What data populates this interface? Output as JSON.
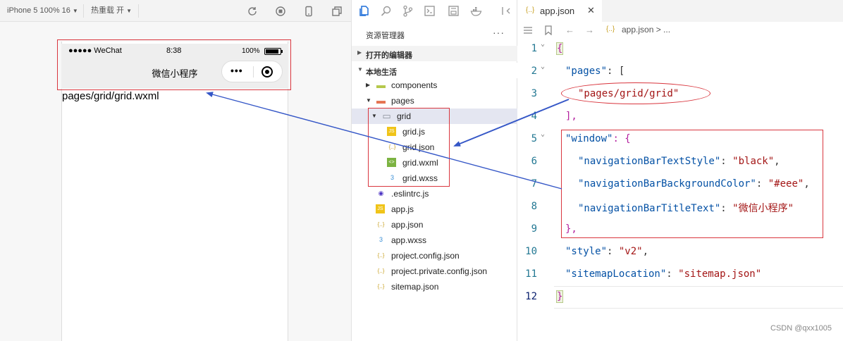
{
  "toolbar": {
    "device": "iPhone 5 100% 16",
    "hot_reload": "热重载 开"
  },
  "simulator": {
    "status": {
      "carrier": "●●●●● WeChat",
      "time": "8:38",
      "battery_pct": "100%",
      "battery_level": 0.92
    },
    "nav_title": "微信小程序",
    "capsule_dots": "•••",
    "page_text": "pages/grid/grid.wxml"
  },
  "explorer": {
    "title": "资源管理器",
    "more": "···",
    "section_open_editors": "打开的编辑器",
    "section_project": "本地生活",
    "tree": [
      {
        "label": "components",
        "icon": "folder-components-icon",
        "color": "#b5c84a"
      },
      {
        "label": "pages",
        "icon": "folder-pages-icon",
        "color": "#e57351"
      },
      {
        "label": "grid",
        "icon": "folder-open-icon",
        "color": "#8a8f99"
      },
      {
        "label": "grid.js",
        "icon": "js-file-icon",
        "color": "#f0c419"
      },
      {
        "label": "grid.json",
        "icon": "json-file-icon",
        "color": "#c9a227"
      },
      {
        "label": "grid.wxml",
        "icon": "wxml-file-icon",
        "color": "#7cb342"
      },
      {
        "label": "grid.wxss",
        "icon": "wxss-file-icon",
        "color": "#3a8fd6"
      },
      {
        "label": ".eslintrc.js",
        "icon": "eslint-file-icon",
        "color": "#4b32c3"
      },
      {
        "label": "app.js",
        "icon": "js-file-icon",
        "color": "#f0c419"
      },
      {
        "label": "app.json",
        "icon": "json-file-icon",
        "color": "#c9a227"
      },
      {
        "label": "app.wxss",
        "icon": "wxss-file-icon",
        "color": "#3a8fd6"
      },
      {
        "label": "project.config.json",
        "icon": "json-file-icon",
        "color": "#c9a227"
      },
      {
        "label": "project.private.config.json",
        "icon": "json-file-icon",
        "color": "#c9a227"
      },
      {
        "label": "sitemap.json",
        "icon": "json-file-icon",
        "color": "#c9a227"
      }
    ]
  },
  "editor": {
    "tab_icon": "{..}",
    "tab_name": "app.json",
    "tab_close": "✕",
    "breadcrumb_file": "app.json",
    "breadcrumb_rest": "> ...",
    "line_numbers": [
      "1",
      "2",
      "3",
      "4",
      "5",
      "6",
      "7",
      "8",
      "9",
      "10",
      "11",
      "12"
    ],
    "lines": {
      "l1": "{",
      "l2_key": "\"pages\"",
      "l2_rest": ": [",
      "l3": "\"pages/grid/grid\"",
      "l4": "],",
      "l5_key": "\"window\"",
      "l5_rest": ": {",
      "l6_key": "\"navigationBarTextStyle\"",
      "l6_sep": ": ",
      "l6_val": "\"black\"",
      "l6_end": ",",
      "l7_key": "\"navigationBarBackgroundColor\"",
      "l7_sep": ": ",
      "l7_val": "\"#eee\"",
      "l7_end": ",",
      "l8_key": "\"navigationBarTitleText\"",
      "l8_sep": ": ",
      "l8_val": "\"微信小程序\"",
      "l9": "},",
      "l10_key": "\"style\"",
      "l10_sep": ": ",
      "l10_val": "\"v2\"",
      "l10_end": ",",
      "l11_key": "\"sitemapLocation\"",
      "l11_sep": ": ",
      "l11_val": "\"sitemap.json\"",
      "l12": "}"
    }
  },
  "watermark": "CSDN @qxx1005",
  "colors": {
    "annotation_red": "#d9363e",
    "arrow_blue": "#3557c7"
  }
}
